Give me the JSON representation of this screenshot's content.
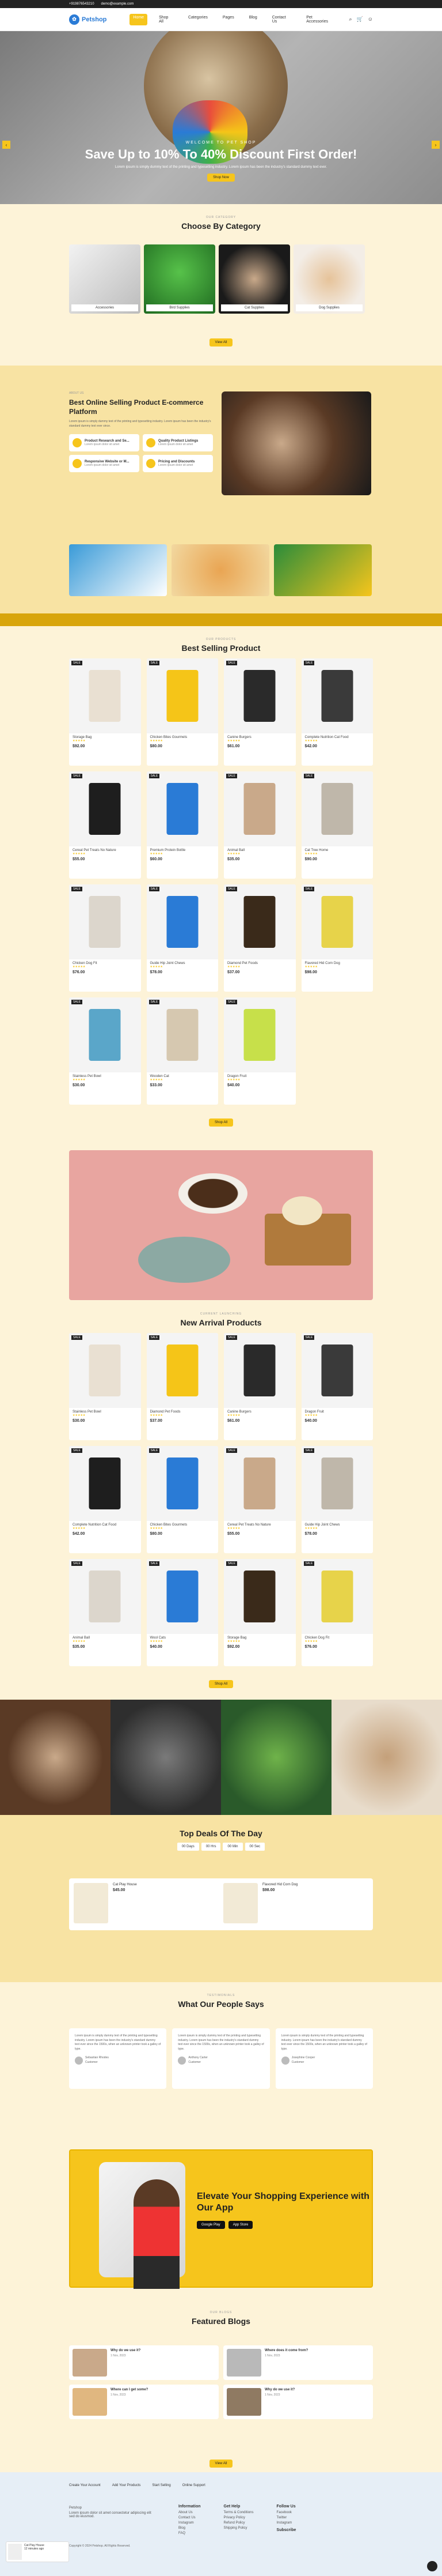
{
  "topbar": {
    "phone": "+919876543210",
    "email": "demo@example.com"
  },
  "header": {
    "logo": "Petshop",
    "nav": [
      "Home",
      "Shop All",
      "Categories",
      "Pages",
      "Blog",
      "Contact Us",
      "Pet Accessories"
    ]
  },
  "hero": {
    "sub": "WELCOME TO PET SHOP",
    "title": "Save Up to 10% To 40% Discount First Order!",
    "desc": "Lorem ipsum is simply dummy text of the printing and typesetting industry. Lorem ipsum has been the industry's standard dummy text ever.",
    "button": "Shop Now"
  },
  "categories": {
    "tag": "OUR CATEGORY",
    "title": "Choose By Category",
    "items": [
      "Accessories",
      "Bird Supplies",
      "Cat Supplies",
      "Dog Supplies"
    ],
    "button": "View All"
  },
  "about": {
    "tag": "ABOUT US",
    "title": "Best Online Selling Product E-commerce Platform",
    "desc": "Lorem ipsum is simply dummy text of the printing and typesetting industry. Lorem ipsum has been the industry's standard dummy text ever since.",
    "features": [
      {
        "title": "Product Research and Se...",
        "desc": "Lorem ipsum dolor sit amet"
      },
      {
        "title": "Quality Product Listings",
        "desc": "Lorem ipsum dolor sit amet"
      },
      {
        "title": "Responsive Website or M...",
        "desc": "Lorem ipsum dolor sit amet"
      },
      {
        "title": "Pricing and Discounts",
        "desc": "Lorem ipsum dolor sit amet"
      }
    ]
  },
  "bestsellers": {
    "tag": "OUR PRODUCTS",
    "title": "Best Selling Product",
    "button": "Shop All",
    "items": [
      {
        "name": "Storage Bag",
        "price": "$92.00"
      },
      {
        "name": "Chicken Bites Gourmets",
        "price": "$80.00"
      },
      {
        "name": "Canine Burgers",
        "price": "$61.00"
      },
      {
        "name": "Complete Nutrition Cat Food",
        "price": "$42.00"
      },
      {
        "name": "Cereal Pet Treats No Nature",
        "price": "$55.00"
      },
      {
        "name": "Premium Protein Bottle",
        "price": "$60.00"
      },
      {
        "name": "Animal Ball",
        "price": "$35.00"
      },
      {
        "name": "Cat Tree Home",
        "price": "$90.00"
      },
      {
        "name": "Chicken Dog Fit",
        "price": "$76.00"
      },
      {
        "name": "Guide Hip Joint Chews",
        "price": "$78.00"
      },
      {
        "name": "Diamond Pet Foods",
        "price": "$37.00"
      },
      {
        "name": "Flavored Hid Corn Dog",
        "price": "$98.00"
      },
      {
        "name": "Stainless Pet Bowl",
        "price": "$30.00"
      },
      {
        "name": "Wooden Cat",
        "price": "$33.00"
      },
      {
        "name": "Dragon Fruit",
        "price": "$40.00"
      }
    ]
  },
  "arrivals": {
    "tag": "CURRENT LAUNCHING",
    "title": "New Arrival Products",
    "button": "Shop All",
    "items": [
      {
        "name": "Stainless Pet Bowl",
        "price": "$30.00"
      },
      {
        "name": "Diamond Pet Foods",
        "price": "$37.00"
      },
      {
        "name": "Canine Burgers",
        "price": "$61.00"
      },
      {
        "name": "Dragon Fruit",
        "price": "$40.00"
      },
      {
        "name": "Complete Nutrition Cat Food",
        "price": "$42.00"
      },
      {
        "name": "Chicken Bites Gourmets",
        "price": "$80.00"
      },
      {
        "name": "Cereal Pet Treats No Nature",
        "price": "$55.00"
      },
      {
        "name": "Guide Hip Joint Chews",
        "price": "$78.00"
      },
      {
        "name": "Animal Ball",
        "price": "$35.00"
      },
      {
        "name": "Wool Cats",
        "price": "$40.00"
      },
      {
        "name": "Storage Bag",
        "price": "$92.00"
      },
      {
        "name": "Chicken Dog Fit",
        "price": "$76.00"
      }
    ]
  },
  "deals": {
    "title": "Top Deals Of The Day",
    "countdown": [
      "00 Days",
      "00 Hrs",
      "00 Min",
      "00 Sec"
    ],
    "items": [
      {
        "name": "Cat Play House",
        "price": "$45.00"
      },
      {
        "name": "Flavored Hid Corn Dog",
        "price": "$98.00"
      }
    ]
  },
  "testimonials": {
    "tag": "TESTIMONIALS",
    "title": "What Our People Says",
    "items": [
      {
        "name": "Sebastian Rhodes",
        "role": "Customer"
      },
      {
        "name": "Anthony Carter",
        "role": "Customer"
      },
      {
        "name": "Josephine Cooper",
        "role": "Customer"
      }
    ],
    "quote": "Lorem ipsum is simply dummy text of the printing and typesetting industry. Lorem ipsum has been the industry's standard dummy text ever since the 1500s, when an unknown printer took a galley of type."
  },
  "app": {
    "title": "Elevate Your Shopping Experience with Our App",
    "google": "Google Play",
    "apple": "App Store"
  },
  "blogs": {
    "tag": "OUR BLOGS",
    "title": "Featured Blogs",
    "button": "View All",
    "items": [
      {
        "title": "Why do we use it?",
        "date": "1 Nov, 2023"
      },
      {
        "title": "Where does it come from?",
        "date": "1 Nov, 2023"
      },
      {
        "title": "Where can I get some?",
        "date": "1 Nov, 2023"
      },
      {
        "title": "Why do we use it?",
        "date": "1 Nov, 2023"
      }
    ]
  },
  "footer": {
    "features": [
      "Create Your Account",
      "Add Your Products",
      "Start Selling",
      "Online Support"
    ],
    "about": "Lorem ipsum dolor sit amet consectetur adipiscing elit sed do eiusmod.",
    "cols": [
      {
        "title": "Information",
        "links": [
          "About Us",
          "Contact Us",
          "Instagram",
          "Blog",
          "FAQ"
        ]
      },
      {
        "title": "Get Help",
        "links": [
          "Terms & Conditions",
          "Privacy Policy",
          "Refund Policy",
          "Shipping Policy"
        ]
      },
      {
        "title": "Follow Us",
        "links": [
          "Facebook",
          "Twitter",
          "Instagram"
        ]
      }
    ],
    "subscribe": "Subscribe",
    "copy": "Copyright © 2024 Petshop. All Rights Reserved."
  },
  "popup": {
    "name": "Cat Play House",
    "time": "12 minutes ago"
  },
  "colors": {
    "accent": "#f6c51c",
    "light": "#fdf3d8",
    "mid": "#f8e3a3"
  }
}
